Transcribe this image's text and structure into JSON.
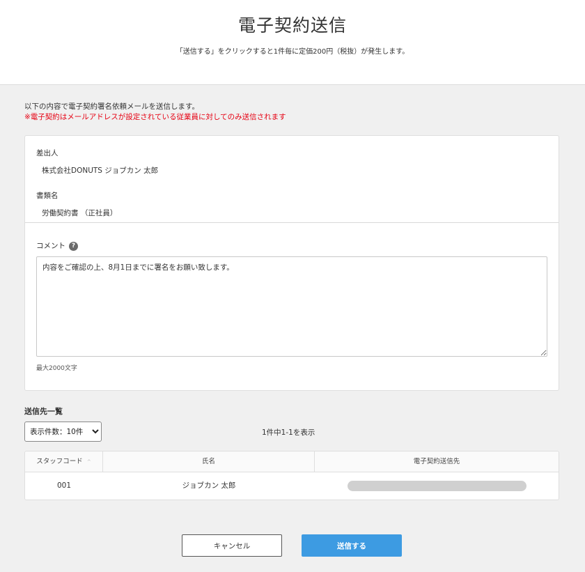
{
  "header": {
    "title": "電子契約送信",
    "subtitle": "「送信する」をクリックすると1件毎に定価200円（税抜）が発生します。"
  },
  "intro": {
    "line1": "以下の内容で電子契約署名依頼メールを送信します。",
    "warning": "※電子契約はメールアドレスが設定されている従業員に対してのみ送信されます"
  },
  "sender": {
    "label": "差出人",
    "value": "株式会社DONUTS ジョブカン 太郎"
  },
  "document": {
    "label": "書類名",
    "value": "労働契約書 （正社員）"
  },
  "comment": {
    "label": "コメント",
    "help_icon": "question-circle-icon",
    "value": "内容をご確認の上、8月1日までに署名をお願い致します。",
    "note": "最大2000文字"
  },
  "recipients": {
    "title": "送信先一覧",
    "per_page": {
      "selected": "表示件数：10件",
      "options": [
        "表示件数：10件"
      ]
    },
    "count_text": "1件中1-1を表示",
    "columns": [
      "スタッフコード",
      "氏名",
      "電子契約送信先"
    ],
    "sort_indicator": "^",
    "rows": [
      {
        "code": "001",
        "name": "ジョブカン 太郎"
      }
    ]
  },
  "buttons": {
    "cancel": "キャンセル",
    "send": "送信する"
  },
  "colors": {
    "primary": "#3d9be2",
    "warning": "#e60012"
  }
}
